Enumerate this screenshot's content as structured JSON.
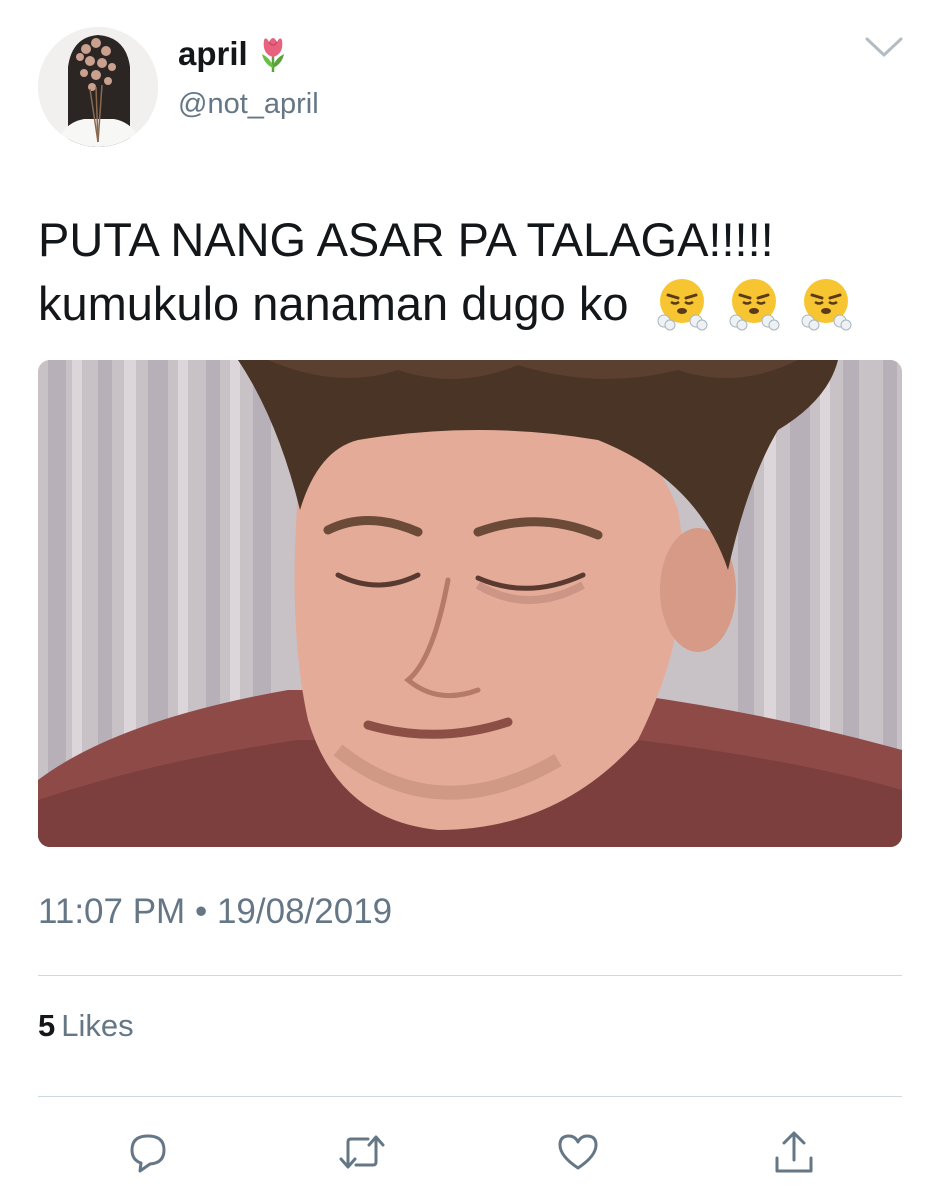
{
  "tweet": {
    "display_name": "april",
    "name_emoji_icon": "tulip-icon",
    "handle": "@not_april",
    "menu_icon": "chevron-down-icon",
    "text_line_1": "PUTA NANG ASAR PA TALAGA!!!!!",
    "text_line_2": "kumukulo nanaman dugo ko",
    "emoji_icons": [
      "face-with-steam-icon",
      "face-with-steam-icon",
      "face-with-steam-icon"
    ],
    "media_description_icon": "photo-man-eyes-closed-icon",
    "time": "11:07 PM",
    "separator": "•",
    "date": "19/08/2019",
    "likes_count": "5",
    "likes_label": "Likes"
  },
  "actions": [
    {
      "icon": "reply-icon"
    },
    {
      "icon": "retweet-icon"
    },
    {
      "icon": "like-heart-icon"
    },
    {
      "icon": "share-icon"
    }
  ],
  "colors": {
    "text_primary": "#14171a",
    "text_secondary": "#657786",
    "divider": "#cfd8dc"
  }
}
